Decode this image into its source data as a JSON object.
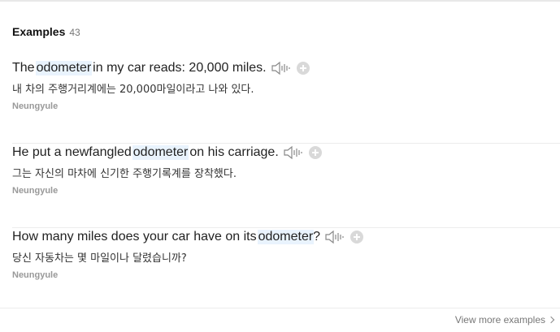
{
  "section": {
    "title": "Examples",
    "count": "43"
  },
  "examples": [
    {
      "en_before": "The",
      "en_keyword": "odometer",
      "en_after": "in my car reads: 20,000 miles.",
      "ko": "내 차의 주행거리계에는 20,000마일이라고 나와 있다.",
      "source": "Neungyule"
    },
    {
      "en_before": "He put a newfangled",
      "en_keyword": "odometer",
      "en_after": "on his carriage.",
      "ko": "그는 자신의 마차에 신기한 주행기록계를 장착했다.",
      "source": "Neungyule"
    },
    {
      "en_before": "How many miles does your car have on its",
      "en_keyword": "odometer",
      "en_after": "?",
      "ko": "당신 자동차는 몇 마일이나 달렸습니까?",
      "source": "Neungyule"
    }
  ],
  "footer": {
    "view_more": "View more examples"
  },
  "icons": {
    "speaker": "speaker-icon",
    "add": "plus-circle-icon",
    "chevron": "chevron-right-icon"
  },
  "colors": {
    "highlight": "#e9f3fd",
    "muted": "#999999"
  }
}
